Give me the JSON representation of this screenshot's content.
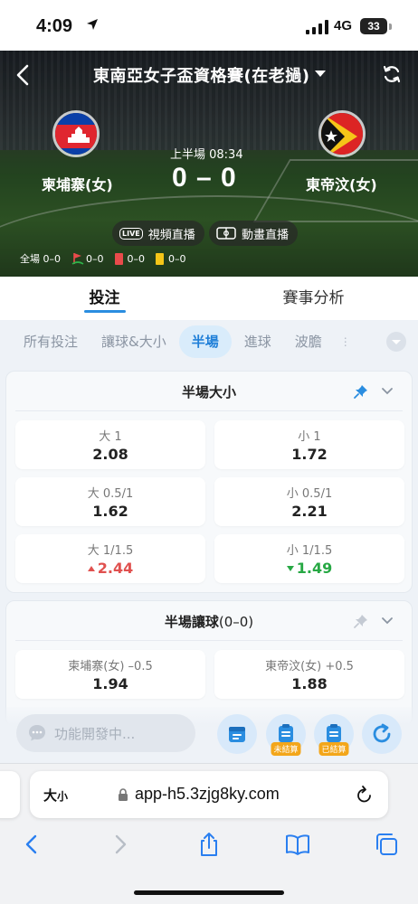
{
  "status_bar": {
    "time": "4:09",
    "network": "4G",
    "battery": "33"
  },
  "header": {
    "title": "東南亞女子盃資格賽(在老撾)",
    "home_team": "柬埔寨(女)",
    "away_team": "東帝汶(女)",
    "period": "上半場 08:34",
    "score": "0 – 0",
    "video_live": "視頻直播",
    "animation_live": "動畫直播",
    "live_tag": "LIVE",
    "stats": {
      "full_time_label": "全場",
      "full_time": "0–0",
      "corners": "0–0",
      "red_cards": "0–0",
      "yellow_cards": "0–0"
    }
  },
  "main_tabs": [
    {
      "label": "投注",
      "active": true
    },
    {
      "label": "賽事分析",
      "active": false
    }
  ],
  "sub_tabs": [
    {
      "label": "所有投注",
      "active": false
    },
    {
      "label": "讓球&大小",
      "active": false
    },
    {
      "label": "半場",
      "active": true
    },
    {
      "label": "進球",
      "active": false
    },
    {
      "label": "波膽",
      "active": false
    }
  ],
  "markets": [
    {
      "title": "半場大小",
      "rows": [
        [
          {
            "label": "大 1",
            "odds": "2.08",
            "trend": "none"
          },
          {
            "label": "小 1",
            "odds": "1.72",
            "trend": "none"
          }
        ],
        [
          {
            "label": "大 0.5/1",
            "odds": "1.62",
            "trend": "none"
          },
          {
            "label": "小 0.5/1",
            "odds": "2.21",
            "trend": "none"
          }
        ],
        [
          {
            "label": "大 1/1.5",
            "odds": "2.44",
            "trend": "up"
          },
          {
            "label": "小 1/1.5",
            "odds": "1.49",
            "trend": "down"
          }
        ]
      ]
    },
    {
      "title": "半場讓球",
      "title_suffix": "(0–0)",
      "rows": [
        [
          {
            "label": "柬埔寨(女) –0.5",
            "odds": "1.94",
            "trend": "none"
          },
          {
            "label": "東帝汶(女) +0.5",
            "odds": "1.88",
            "trend": "none"
          }
        ]
      ]
    }
  ],
  "float_bar": {
    "chat_placeholder": "功能開發中...",
    "unsettled_label": "未結算",
    "settled_label": "已結算"
  },
  "browser": {
    "aa_label": "大",
    "aa_small": "小",
    "url": "app-h5.3zjg8ky.com"
  },
  "colors": {
    "accent": "#2a8de0",
    "up": "#e0514f",
    "down": "#27a844",
    "badge": "#f3a61a"
  }
}
